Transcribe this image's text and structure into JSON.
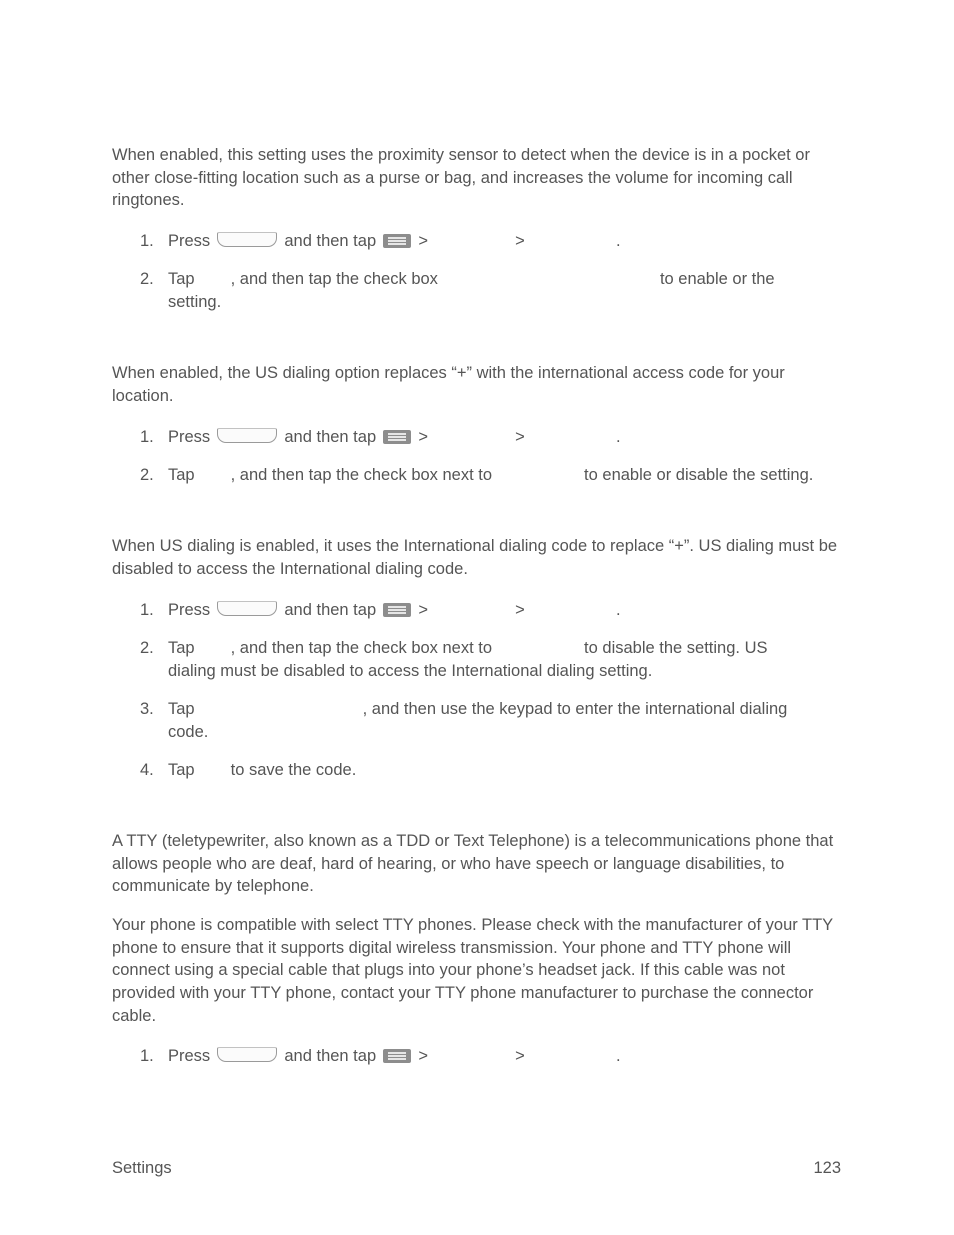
{
  "sections": [
    {
      "heading": "",
      "intro": "When enabled, this setting uses the proximity sensor to detect when the device is in a pocket or other close-fitting location such as a purse or bag, and increases the volume for incoming call ringtones.",
      "steps": [
        {
          "num": "1.",
          "parts": [
            "Press",
            "and then tap",
            ">",
            ">",
            "."
          ]
        },
        {
          "num": "2.",
          "line1": [
            "Tap",
            ", and then tap the check box",
            "to enable or the"
          ],
          "line2": "setting."
        }
      ]
    },
    {
      "heading": "",
      "intro": "When enabled, the US dialing option replaces “+” with the international access code for your location.",
      "steps": [
        {
          "num": "1.",
          "parts": [
            "Press",
            "and then tap",
            ">",
            ">",
            "."
          ]
        },
        {
          "num": "2.",
          "line1": [
            "Tap",
            ", and then tap the check box next to",
            "to enable or disable the setting."
          ]
        }
      ]
    },
    {
      "heading": "",
      "intro": "When US dialing is enabled, it uses the International dialing code to replace “+”. US dialing must be disabled to access the International dialing code.",
      "steps": [
        {
          "num": "1.",
          "parts": [
            "Press",
            "and then tap",
            ">",
            ">",
            "."
          ]
        },
        {
          "num": "2.",
          "line1": [
            "Tap",
            ", and then tap the check box next to",
            "to disable the setting. US"
          ],
          "line2": "dialing must be disabled to access the International dialing setting."
        },
        {
          "num": "3.",
          "line1": [
            "Tap",
            ", and then use the keypad to enter the international dialing"
          ],
          "line2": "code."
        },
        {
          "num": "4.",
          "line1": [
            "Tap",
            "to save the code."
          ]
        }
      ]
    },
    {
      "heading": "",
      "intro": "A TTY (teletypewriter, also known as a TDD or Text Telephone) is a telecommunications phone that allows people who are deaf, hard of hearing, or who have speech or language disabilities, to communicate by telephone.",
      "intro2": "Your phone is compatible with select TTY phones. Please check with the manufacturer of your TTY phone to ensure that it supports digital wireless transmission. Your phone and TTY phone will connect using a special cable that plugs into your phone’s headset jack. If this cable was not provided with your TTY phone, contact your TTY phone manufacturer to purchase the connector cable.",
      "steps": [
        {
          "num": "1.",
          "parts": [
            "Press",
            "and then tap",
            ">",
            ">",
            "."
          ]
        }
      ]
    }
  ],
  "icons": {
    "home": "home-key-icon",
    "menu": "menu-key-icon"
  },
  "footer": {
    "section": "Settings",
    "page": "123"
  }
}
